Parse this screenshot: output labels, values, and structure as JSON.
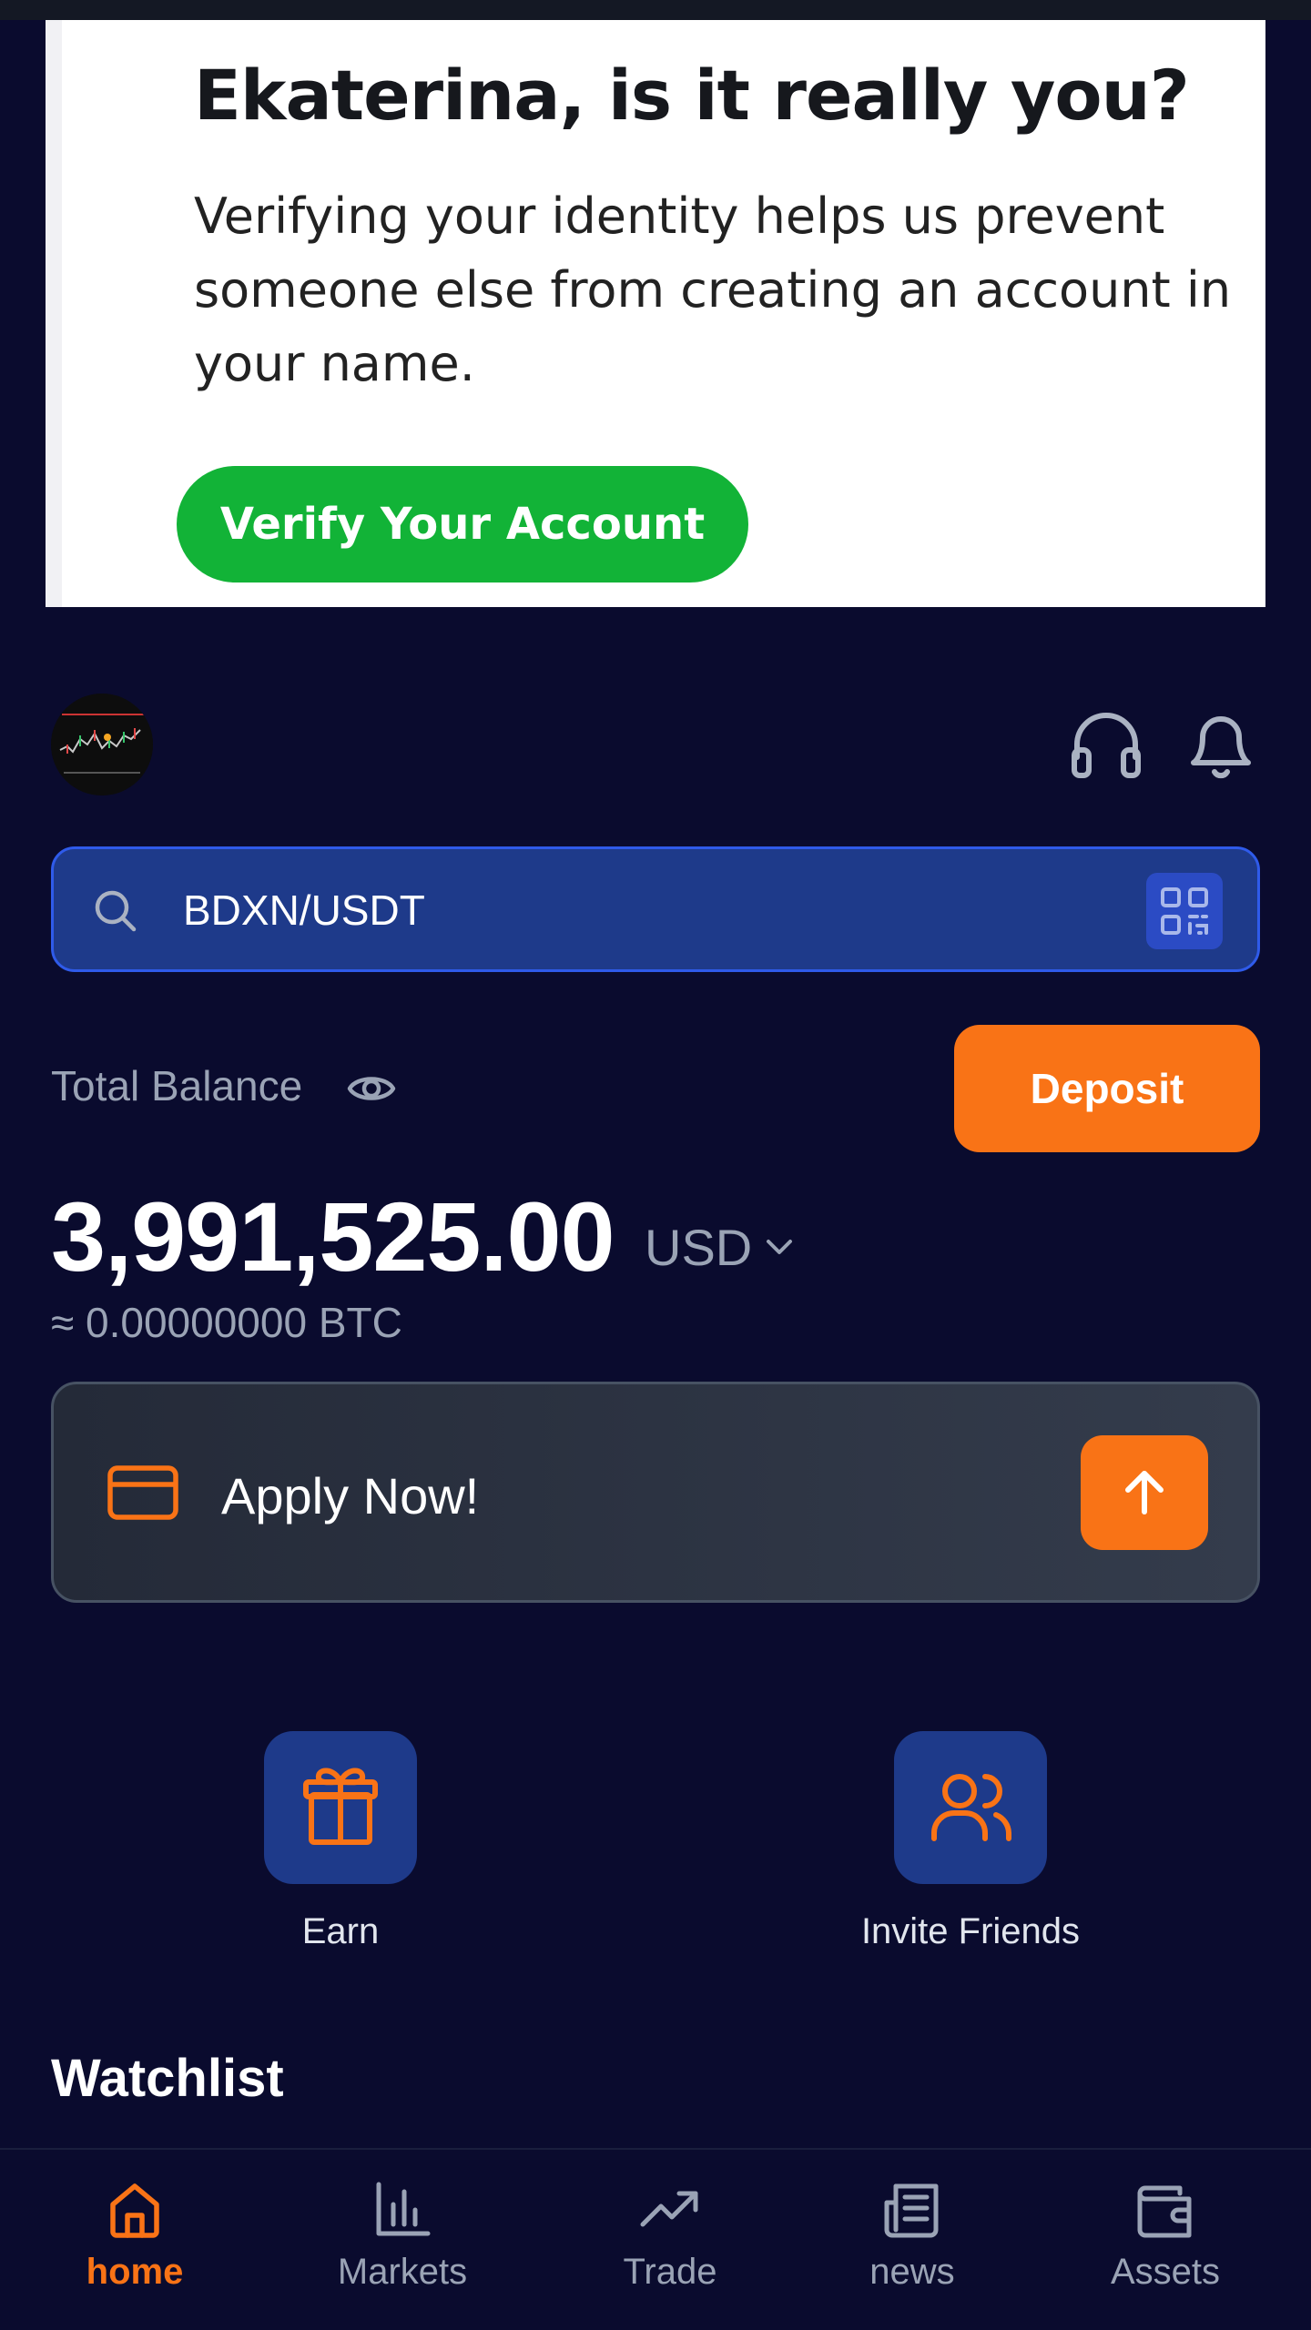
{
  "ad_banner": {
    "title": "Ekaterina, is it really you?",
    "body": "Verifying your identity helps us prevent someone else from creating an account in your name.",
    "button_label": "Verify Your Account",
    "button_color": "#12b337"
  },
  "header": {
    "avatar_icon": "chart-avatar",
    "support_icon": "headphones-icon",
    "notifications_icon": "bell-icon"
  },
  "search": {
    "value": "BDXN/USDT",
    "search_icon": "search-icon",
    "scan_icon": "qr-code-icon"
  },
  "balance": {
    "label": "Total Balance",
    "visibility_icon": "eye-icon",
    "deposit_label": "Deposit",
    "amount": "3,991,525.00",
    "currency": "USD",
    "btc_equivalent": "≈ 0.00000000 BTC"
  },
  "apply_card": {
    "icon": "credit-card-icon",
    "label": "Apply Now!",
    "action_icon": "arrow-up-icon"
  },
  "shortcuts": [
    {
      "label": "Earn",
      "icon": "gift-icon"
    },
    {
      "label": "Invite Friends",
      "icon": "users-icon"
    }
  ],
  "watchlist": {
    "title": "Watchlist"
  },
  "bottom_nav": {
    "items": [
      {
        "label": "home",
        "icon": "home-icon",
        "active": true
      },
      {
        "label": "Markets",
        "icon": "bar-chart-icon",
        "active": false
      },
      {
        "label": "Trade",
        "icon": "trending-up-icon",
        "active": false
      },
      {
        "label": "news",
        "icon": "newspaper-icon",
        "active": false
      },
      {
        "label": "Assets",
        "icon": "wallet-icon",
        "active": false
      }
    ]
  },
  "colors": {
    "background": "#0a0b2e",
    "accent": "#f97316",
    "tile": "#1e3a8a",
    "muted_text": "#9aa3b5"
  }
}
